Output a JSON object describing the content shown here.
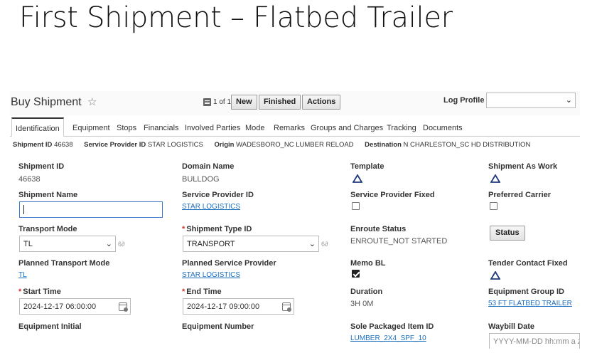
{
  "slide": {
    "title": "First Shipment – Flatbed Trailer"
  },
  "header": {
    "title": "Buy Shipment",
    "pager": "1 of 1",
    "buttons": {
      "new": "New",
      "finished": "Finished",
      "actions": "Actions"
    },
    "log_profile_label": "Log Profile",
    "log_profile_value": ""
  },
  "tabs": [
    {
      "label": "Identification",
      "active": true
    },
    {
      "label": "Equipment"
    },
    {
      "label": "Stops"
    },
    {
      "label": "Financials"
    },
    {
      "label": "Involved Parties"
    },
    {
      "label": "Mode"
    },
    {
      "label": "Remarks"
    },
    {
      "label": "Groups and Charges"
    },
    {
      "label": "Tracking"
    },
    {
      "label": "Documents"
    }
  ],
  "summary": {
    "shipment_id_label": "Shipment ID",
    "shipment_id": "46638",
    "provider_label": "Service Provider ID",
    "provider": "STAR LOGISTICS",
    "origin_label": "Origin",
    "origin": "WADESBORO_NC LUMBER RELOAD",
    "destination_label": "Destination",
    "destination": "N CHARLESTON_SC HD DISTRIBUTION"
  },
  "fields": {
    "shipment_id": {
      "label": "Shipment ID",
      "value": "46638"
    },
    "domain_name": {
      "label": "Domain Name",
      "value": "BULLDOG"
    },
    "template": {
      "label": "Template"
    },
    "shipment_as_work": {
      "label": "Shipment As Work"
    },
    "shipment_name": {
      "label": "Shipment Name",
      "value": ""
    },
    "service_provider_id": {
      "label": "Service Provider ID",
      "value": "STAR LOGISTICS"
    },
    "service_provider_fixed": {
      "label": "Service Provider Fixed",
      "checked": false
    },
    "preferred_carrier": {
      "label": "Preferred Carrier",
      "checked": false
    },
    "transport_mode": {
      "label": "Transport Mode",
      "value": "TL"
    },
    "shipment_type_id": {
      "label": "Shipment Type ID",
      "value": "TRANSPORT"
    },
    "enroute_status": {
      "label": "Enroute Status",
      "value": "ENROUTE_NOT STARTED"
    },
    "status_button": "Status",
    "planned_transport_mode": {
      "label": "Planned Transport Mode",
      "value": "TL"
    },
    "planned_service_provider": {
      "label": "Planned Service Provider",
      "value": "STAR LOGISTICS"
    },
    "memo_bl": {
      "label": "Memo BL",
      "checked": true
    },
    "tender_contact_fixed": {
      "label": "Tender Contact Fixed"
    },
    "start_time": {
      "label": "Start Time",
      "value": "2024-12-17 06:00:00"
    },
    "end_time": {
      "label": "End Time",
      "value": "2024-12-17 09:00:00"
    },
    "duration": {
      "label": "Duration",
      "value": "3H 0M"
    },
    "equipment_group_id": {
      "label": "Equipment Group ID",
      "value": "53 FT FLATBED TRAILER"
    },
    "equipment_initial": {
      "label": "Equipment Initial"
    },
    "equipment_number": {
      "label": "Equipment Number"
    },
    "sole_packaged_item_id": {
      "label": "Sole Packaged Item ID",
      "value": "LUMBER_2X4_SPF_10"
    },
    "waybill_date": {
      "label": "Waybill Date",
      "placeholder": "YYYY-MM-DD hh:mm a z"
    }
  },
  "icons": {
    "star": "star-icon",
    "triangle": "triangle-icon",
    "calendar": "calendar-icon",
    "list": "list-icon",
    "chevron": "chevron-down-icon"
  },
  "colors": {
    "link": "#1a6fbf",
    "required": "#cc3333",
    "focus": "#3a7ac5"
  }
}
